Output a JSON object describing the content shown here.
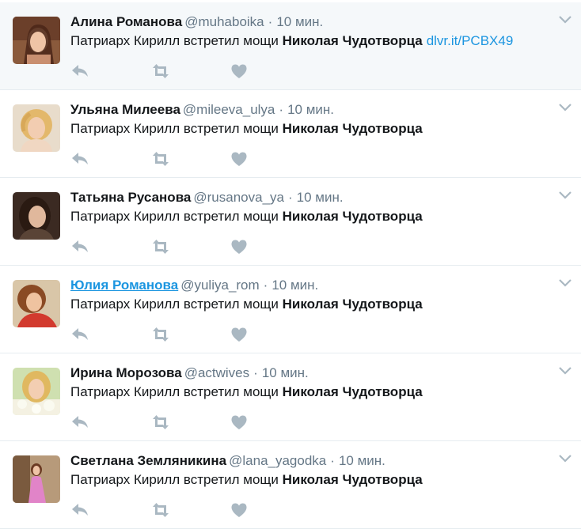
{
  "colors": {
    "action": "#aab8c2",
    "link": "#1b95e0",
    "meta": "#657786",
    "highlight_bg": "#f5f8fa",
    "divider": "#e6ecf0"
  },
  "icons": {
    "reply": "reply-icon",
    "retweet": "retweet-icon",
    "like": "heart-icon",
    "caret": "chevron-down-icon"
  },
  "tweets": [
    {
      "name": "Алина Романова",
      "handle": "@muhaboika",
      "sep": "·",
      "time": "10 мин.",
      "text_plain": "Патриарх Кирилл встретил мощи",
      "text_bold": "Николая Чудотворца",
      "url": "dlvr.it/PCBX49"
    },
    {
      "name": "Ульяна Милеева",
      "handle": "@mileeva_ulya",
      "sep": "·",
      "time": "10 мин.",
      "text_plain": "Патриарх Кирилл встретил мощи",
      "text_bold": "Николая Чудотворца",
      "url": ""
    },
    {
      "name": "Татьяна Русанова",
      "handle": "@rusanova_ya",
      "sep": "·",
      "time": "10 мин.",
      "text_plain": "Патриарх Кирилл встретил мощи",
      "text_bold": "Николая Чудотворца",
      "url": ""
    },
    {
      "name": "Юлия Романова",
      "handle": "@yuliya_rom",
      "sep": "·",
      "time": "10 мин.",
      "text_plain": "Патриарх Кирилл встретил мощи",
      "text_bold": "Николая Чудотворца",
      "url": ""
    },
    {
      "name": "Ирина Морозова",
      "handle": "@actwives",
      "sep": "·",
      "time": "10 мин.",
      "text_plain": "Патриарх Кирилл встретил мощи",
      "text_bold": "Николая Чудотворца",
      "url": ""
    },
    {
      "name": "Светлана Земляникина",
      "handle": "@lana_yagodka",
      "sep": "·",
      "time": "10 мин.",
      "text_plain": "Патриарх Кирилл встретил мощи",
      "text_bold": "Николая Чудотворца",
      "url": ""
    }
  ]
}
